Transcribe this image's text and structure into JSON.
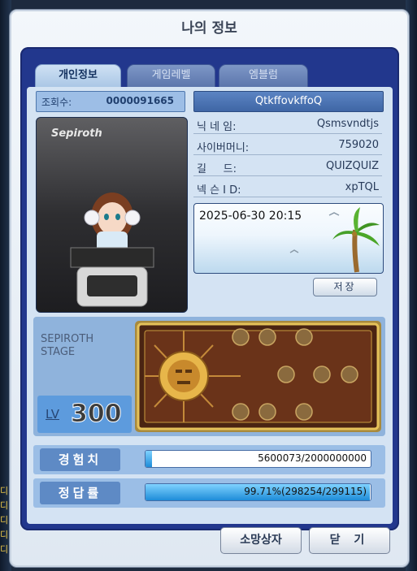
{
  "window": {
    "title": "나의 정보"
  },
  "tabs": [
    {
      "label": "개인정보",
      "active": true
    },
    {
      "label": "게임레벨",
      "active": false
    },
    {
      "label": "엠블럼",
      "active": false
    }
  ],
  "profile": {
    "views_label": "조회수:",
    "views_value": "0000091665",
    "id": "QtkffovkffoQ",
    "character_tag": "Sepiroth",
    "fields": [
      {
        "label": "닉 네 임:",
        "value": "Qsmsvndtjs"
      },
      {
        "label": "사이버머니:",
        "value": "759020"
      },
      {
        "label": "길     드:",
        "value": "QUIZQUIZ"
      },
      {
        "label": "넥 슨 I D:",
        "value": "xpTQL"
      }
    ],
    "memo": "2025-06-30 20:15",
    "save_label": "저장"
  },
  "stage": {
    "name_line1": "SEPIROTH",
    "name_line2": "STAGE",
    "level_label": "LV",
    "level_value": "300"
  },
  "stats": [
    {
      "label": "경험치",
      "value_text": "5600073/2000000000",
      "fraction": 0.0028
    },
    {
      "label": "정답률",
      "value_text": "99.71%(298254/299115)",
      "fraction": 0.9971
    }
  ],
  "buttons": {
    "wish_box": "소망상자",
    "close": "닫 기"
  },
  "background": {
    "notices": [
      "디",
      "디",
      "디",
      "디",
      "디"
    ]
  },
  "colors": {
    "frame": "#22378d",
    "accent": "#5e8ac5",
    "bar_fill": "#1e8cd8"
  }
}
